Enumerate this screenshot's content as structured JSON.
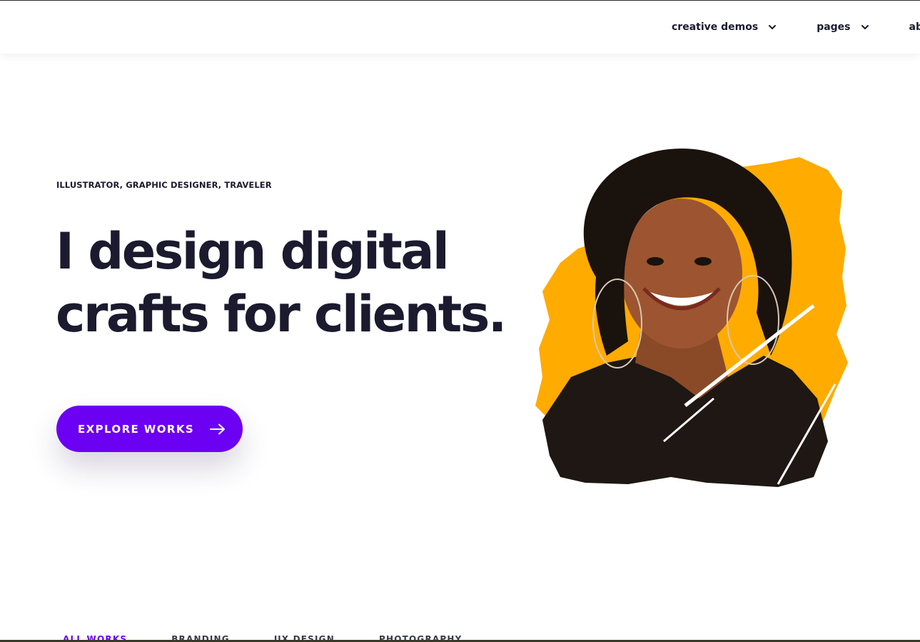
{
  "header": {
    "nav": [
      {
        "label": "creative demos",
        "icon": "chevron-down-icon"
      },
      {
        "label": "pages",
        "icon": "chevron-down-icon"
      },
      {
        "label": "ab"
      }
    ]
  },
  "hero": {
    "kicker": "ILLUSTRATOR, GRAPHIC DESIGNER, TRAVELER",
    "headline_line1": "I design digital",
    "headline_line2": "crafts for clients.",
    "cta_label": "EXPLORE WORKS",
    "cta_icon": "arrow-right-icon",
    "accent_color": "#6c00f2",
    "brush_color": "#ffab00",
    "portrait_image": "portrait-photo"
  },
  "portfolio_filters": [
    {
      "label": "ALL WORKS",
      "active": true
    },
    {
      "label": "BRANDING"
    },
    {
      "label": "UX DESIGN"
    },
    {
      "label": "PHOTOGRAPHY"
    }
  ]
}
